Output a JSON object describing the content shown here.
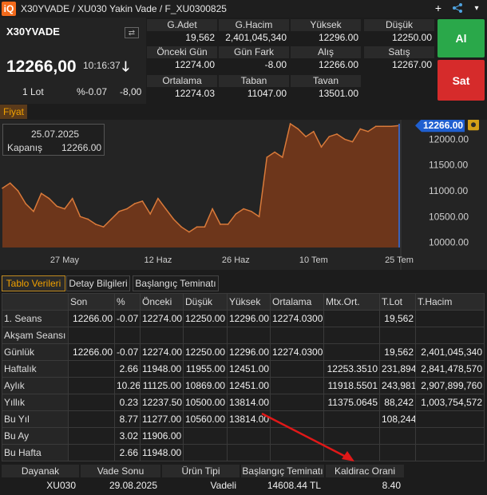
{
  "window": {
    "title": "X30YVADE / XU030 Yakin Vade / F_XU0300825",
    "logo": "iQ"
  },
  "title_icons": [
    "plus-icon",
    "share-icon",
    "chevron-down-icon"
  ],
  "quote": {
    "symbol": "X30YVADE",
    "last": "12266,00",
    "time": "10:16:37",
    "direction_icon": "arrow-down-icon",
    "lot": "1 Lot",
    "pct": "%-0.07",
    "change": "-8,00",
    "cells": [
      {
        "label": "G.Adet",
        "value": "19,562"
      },
      {
        "label": "G.Hacim",
        "value": "2,401,045,340"
      },
      {
        "label": "Yüksek",
        "value": "12296.00"
      },
      {
        "label": "Düşük",
        "value": "12250.00"
      },
      {
        "label": "Önceki Gün",
        "value": "12274.00"
      },
      {
        "label": "Gün Fark",
        "value": "-8.00"
      },
      {
        "label": "Alış",
        "value": "12266.00"
      },
      {
        "label": "Satış",
        "value": "12267.00"
      },
      {
        "label": "Ortalama",
        "value": "12274.03"
      },
      {
        "label": "Taban",
        "value": "11047.00"
      },
      {
        "label": "Tavan",
        "value": "13501.00"
      }
    ],
    "buy_label": "Al",
    "sell_label": "Sat",
    "buy_color": "#2aa84a",
    "sell_color": "#d62b2b"
  },
  "chart_tab": "Fiyat",
  "chart_info": {
    "date": "25.07.2025",
    "label": "Kapanış",
    "value": "12266.00"
  },
  "chart_data": {
    "type": "area",
    "x": [
      "2025-05-15",
      "2025-05-16",
      "2025-05-19",
      "2025-05-20",
      "2025-05-21",
      "2025-05-22",
      "2025-05-23",
      "2025-05-26",
      "2025-05-27",
      "2025-05-28",
      "2025-05-29",
      "2025-05-30",
      "2025-06-02",
      "2025-06-03",
      "2025-06-04",
      "2025-06-05",
      "2025-06-06",
      "2025-06-09",
      "2025-06-10",
      "2025-06-11",
      "2025-06-12",
      "2025-06-13",
      "2025-06-16",
      "2025-06-17",
      "2025-06-18",
      "2025-06-19",
      "2025-06-20",
      "2025-06-23",
      "2025-06-24",
      "2025-06-25",
      "2025-06-26",
      "2025-06-27",
      "2025-06-30",
      "2025-07-01",
      "2025-07-02",
      "2025-07-03",
      "2025-07-04",
      "2025-07-07",
      "2025-07-08",
      "2025-07-09",
      "2025-07-10",
      "2025-07-11",
      "2025-07-14",
      "2025-07-15",
      "2025-07-16",
      "2025-07-17",
      "2025-07-18",
      "2025-07-21",
      "2025-07-22",
      "2025-07-23",
      "2025-07-24",
      "2025-07-25"
    ],
    "values": [
      11050,
      11150,
      11000,
      10750,
      10600,
      10950,
      10850,
      10700,
      10650,
      10850,
      10500,
      10450,
      10350,
      10300,
      10450,
      10600,
      10650,
      10750,
      10800,
      10550,
      10850,
      10650,
      10450,
      10300,
      10200,
      10300,
      10300,
      10650,
      10350,
      10350,
      10550,
      10650,
      10600,
      10500,
      11650,
      11750,
      11650,
      12300,
      12200,
      12050,
      12150,
      11850,
      12050,
      12100,
      12000,
      11950,
      12200,
      12150,
      12250,
      12250,
      12250,
      12266
    ],
    "x_ticks": [
      "27 May",
      "12 Haz",
      "26 Haz",
      "10 Tem",
      "25 Tem"
    ],
    "y_ticks": [
      "12000.00",
      "11500.00",
      "11000.00",
      "10500.00",
      "10000.00"
    ],
    "ylim": [
      9900,
      12300
    ],
    "last_label": "12266.00",
    "line_color": "#d97a3a",
    "fill_color": "#7a3a1a"
  },
  "tabs": [
    "Tablo Verileri",
    "Detay Bilgileri",
    "Başlangıç Teminatı"
  ],
  "table": {
    "headers": [
      "",
      "Son",
      "%",
      "Önceki",
      "Düşük",
      "Yüksek",
      "Ortalama",
      "Mtx.Ort.",
      "T.Lot",
      "T.Hacim"
    ],
    "rows": [
      [
        "1. Seans",
        "12266.00",
        "-0.07",
        "12274.00",
        "12250.00",
        "12296.00",
        "12274.0300",
        "",
        "19,562",
        ""
      ],
      [
        "Akşam Seansı",
        "",
        "",
        "",
        "",
        "",
        "",
        "",
        "",
        ""
      ],
      [
        "Günlük",
        "12266.00",
        "-0.07",
        "12274.00",
        "12250.00",
        "12296.00",
        "12274.0300",
        "",
        "19,562",
        "2,401,045,340"
      ],
      [
        "Haftalık",
        "",
        "2.66",
        "11948.00",
        "11955.00",
        "12451.00",
        "",
        "12253.3510",
        "231,894",
        "2,841,478,570"
      ],
      [
        "Aylık",
        "",
        "10.26",
        "11125.00",
        "10869.00",
        "12451.00",
        "",
        "11918.5501",
        "243,981",
        "2,907,899,760"
      ],
      [
        "Yıllık",
        "",
        "0.23",
        "12237.50",
        "10500.00",
        "13814.00",
        "",
        "11375.0645",
        "88,242",
        "1,003,754,572"
      ],
      [
        "Bu Yıl",
        "",
        "8.77",
        "11277.00",
        "10560.00",
        "13814.00",
        "",
        "",
        "108,244",
        ""
      ],
      [
        "Bu Ay",
        "",
        "3.02",
        "11906.00",
        "",
        "",
        "",
        "",
        "",
        ""
      ],
      [
        "Bu Hafta",
        "",
        "2.66",
        "11948.00",
        "",
        "",
        "",
        "",
        "",
        ""
      ]
    ]
  },
  "footer": [
    {
      "label": "Dayanak",
      "value": "XU030"
    },
    {
      "label": "Vade Sonu",
      "value": "29.08.2025"
    },
    {
      "label": "Ürün Tipi",
      "value": "Vadeli"
    },
    {
      "label": "Başlangıç Teminatı",
      "value": "14608.44 TL"
    },
    {
      "label": "Kaldirac Orani",
      "value": "8.40"
    }
  ]
}
